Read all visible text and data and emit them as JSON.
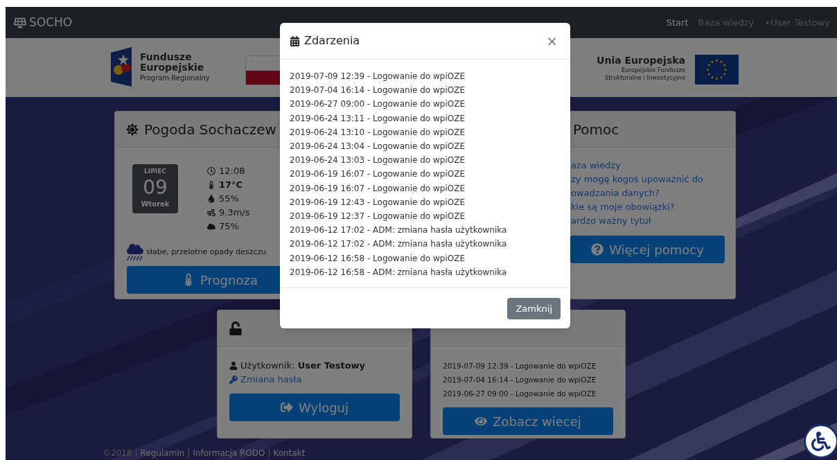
{
  "navbar": {
    "brand": "SOCHO",
    "links": [
      {
        "label": "Start",
        "selected": true,
        "kind": "link"
      },
      {
        "label": "Baza wiedzy",
        "selected": false,
        "kind": "link"
      },
      {
        "label": "User Testowy",
        "selected": false,
        "kind": "dropdown"
      }
    ]
  },
  "logos": {
    "left": {
      "title_lines": [
        "Fundusze",
        "Europejskie"
      ],
      "subtitle": "Program Regionalny"
    },
    "right": {
      "title": "Unia Europejska",
      "subtitle_lines": [
        "Europejskie Fundusze",
        "Strukturalne i Inwestycyjne"
      ]
    }
  },
  "weather": {
    "title": "Pogoda Sochaczew",
    "month": "LIPIEC",
    "day": "09",
    "weekday": "Wtorek",
    "details": [
      {
        "kind": "time",
        "text": "12:08"
      },
      {
        "kind": "temperature",
        "text": "17°C"
      },
      {
        "kind": "humidity",
        "text": "55%"
      },
      {
        "kind": "wind",
        "text": "9.3m/s"
      },
      {
        "kind": "clouds",
        "text": "75%"
      }
    ],
    "description": "słabe, przelotne opady deszczu",
    "button": "Prognoza"
  },
  "help": {
    "title": "Pomoc",
    "lines": [
      "aza wiedzy",
      "zy mogę kogoś upoważnić do",
      "owadzania danych?",
      "kie są moje obowiązki?",
      "ardzo ważny tytuł"
    ],
    "button": "Więcej pomocy"
  },
  "user": {
    "label": "Użytkownik:",
    "name": "User Testowy",
    "link": "Zmiana hasła",
    "button": "Wyloguj"
  },
  "events": {
    "items": [
      "2019-07-09 12:39 - Logowanie do wpiOZE",
      "2019-07-04 16:14 - Logowanie do wpiOZE",
      "2019-06-27 09:00 - Logowanie do wpiOZE"
    ],
    "button": "Zobacz wiecej"
  },
  "footer": {
    "copyright": "©2018",
    "separator": "|",
    "links": [
      "Regulamin",
      "Informacja RODO",
      "Kontakt"
    ]
  },
  "modal": {
    "title": "Zdarzenia",
    "close": "×",
    "items": [
      "2019-07-09 12:39 - Logowanie do wpiOZE",
      "2019-07-04 16:14 - Logowanie do wpiOZE",
      "2019-06-27 09:00 - Logowanie do wpiOZE",
      "2019-06-24 13:11 - Logowanie do wpiOZE",
      "2019-06-24 13:10 - Logowanie do wpiOZE",
      "2019-06-24 13:04 - Logowanie do wpiOZE",
      "2019-06-24 13:03 - Logowanie do wpiOZE",
      "2019-06-19 16:07 - Logowanie do wpiOZE",
      "2019-06-19 16:07 - Logowanie do wpiOZE",
      "2019-06-19 12:43 - Logowanie do wpiOZE",
      "2019-06-19 12:37 - Logowanie do wpiOZE",
      "2019-06-12 17:02 - ADM: zmiana hasła użytkownika",
      "2019-06-12 17:02 - ADM: zmiana hasła użytkownika",
      "2019-06-12 16:58 - Logowanie do wpiOZE",
      "2019-06-12 16:58 - ADM: zmiana hasła użytkownika"
    ],
    "button": "Zamknij"
  }
}
